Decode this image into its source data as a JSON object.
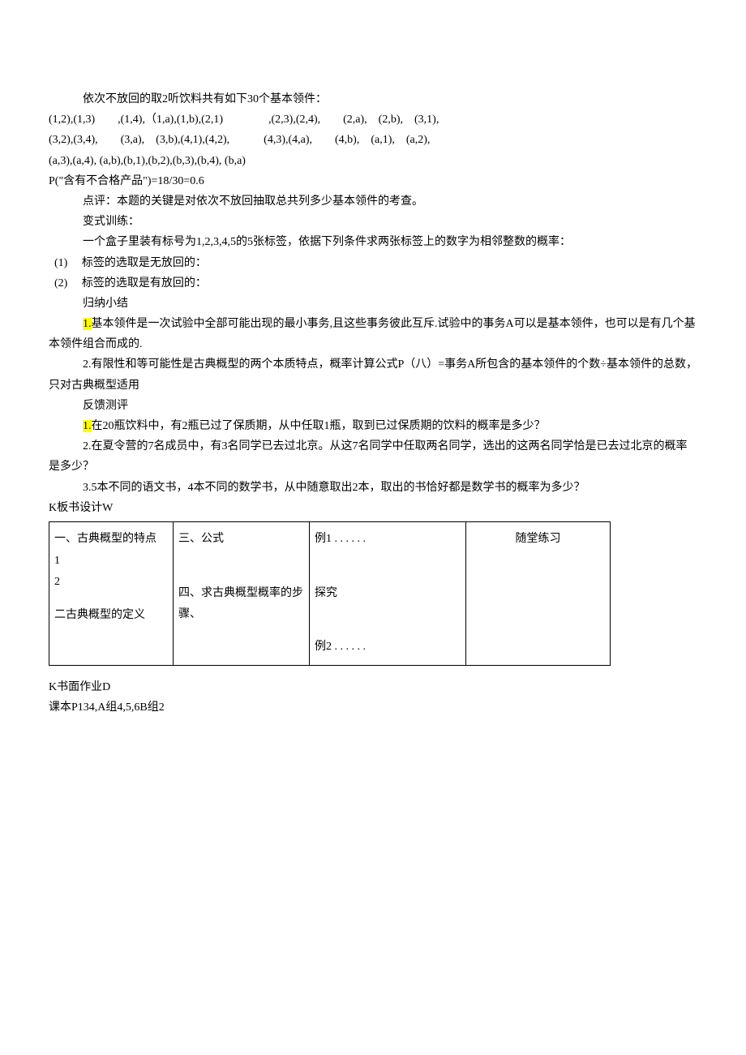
{
  "lines": {
    "l1": "依次不放回的取2听饮料共有如下30个基本领件：",
    "l2": "(1,2),(1,3)  ,(1,4),（1,a),(1,b),(2,1)    ,(2,3),(2,4),  (2,a), (2,b), (3,1),",
    "l3": "(3,2),(3,4),  (3,a), (3,b),(4,1),(4,2),   (4,3),(4,a),  (4,b), (a,1), (a,2),",
    "l4": "(a,3),(a,4), (a,b),(b,1),(b,2),(b,3),(b,4), (b,a)",
    "l5": "P(\"含有不合格产品\")=18/30=0.6",
    "l6": "点评：本题的关键是对依次不放回抽取总共列多少基本领件的考查。",
    "l7": "变式训练：",
    "l8": "一个盒子里装有标号为1,2,3,4,5的5张标签，依据下列条件求两张标签上的数字为相邻整数的概率：",
    "l9": "(1)  标签的选取是无放回的：",
    "l10": "(2)  标签的选取是有放回的：",
    "l11": "归纳小结",
    "l12a": "1.",
    "l12b": "基本领件是一次试验中全部可能出现的最小事务,且这些事务彼此互斥.试验中的事务A可以是基本领件，也可以是有几个基本领件组合而成的.",
    "l13": "2.有限性和等可能性是古典概型的两个本质特点，概率计算公式P（八）=事务A所包含的基本领件的个数÷基本领件的总数，只对古典概型适用",
    "l14": "反馈测评",
    "l15a": "1.",
    "l15b": "在20瓶饮料中，有2瓶已过了保质期，从中任取1瓶，取到已过保质期的饮料的概率是多少？",
    "l16": "2.在夏令营的7名成员中，有3名同学已去过北京。从这7名同学中任取两名同学，选出的这两名同学恰是已去过北京的概率是多少？",
    "l17": "3.5本不同的语文书，4本不同的数学书，从中随意取出2本，取出的书恰好都是数学书的概率为多少？",
    "boardLabel": "K板书设计W",
    "homeworkLabel": "K书面作业D",
    "homework": "课本P134,A组4,5,6B组2"
  },
  "board": {
    "c1a": "一、古典概型的特点",
    "c1b": "1",
    "c1c": "2",
    "c1d": "二古典概型的定义",
    "c2a": "三、公式",
    "c2b": "四、求古典概型概率的步骤、",
    "c3a": "例1 . . . . . .",
    "c3b": "探究",
    "c3c": "例2 . . . . . .",
    "c4a": "随堂练习"
  }
}
